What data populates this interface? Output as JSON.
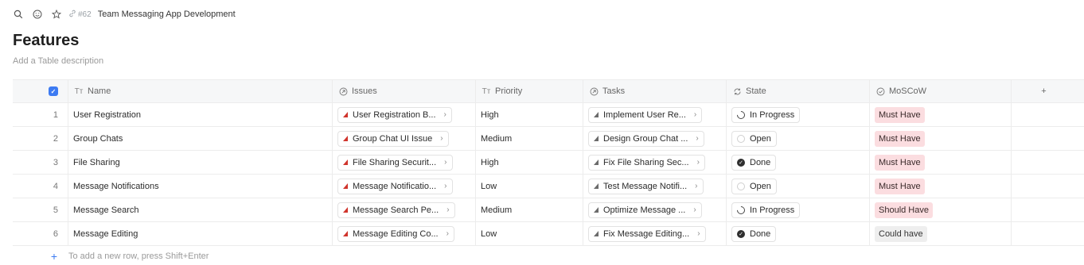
{
  "topbar": {
    "ref": "#62",
    "breadcrumb": "Team Messaging App Development"
  },
  "page": {
    "title": "Features",
    "description_placeholder": "Add a Table description"
  },
  "columns": {
    "name": "Name",
    "issues": "Issues",
    "priority": "Priority",
    "tasks": "Tasks",
    "state": "State",
    "moscow": "MoSCoW",
    "add": "+"
  },
  "rows": [
    {
      "idx": "1",
      "name": "User Registration",
      "issue": "User Registration B...",
      "priority": "High",
      "task": "Implement User Re...",
      "state": "In Progress",
      "state_kind": "progress",
      "moscow": "Must Have",
      "moscow_kind": "must"
    },
    {
      "idx": "2",
      "name": "Group Chats",
      "issue": "Group Chat UI Issue",
      "priority": "Medium",
      "task": "Design Group Chat ...",
      "state": "Open",
      "state_kind": "open",
      "moscow": "Must Have",
      "moscow_kind": "must"
    },
    {
      "idx": "3",
      "name": "File Sharing",
      "issue": "File Sharing Securit...",
      "priority": "High",
      "task": "Fix File Sharing Sec...",
      "state": "Done",
      "state_kind": "done",
      "moscow": "Must Have",
      "moscow_kind": "must"
    },
    {
      "idx": "4",
      "name": "Message Notifications",
      "issue": "Message Notificatio...",
      "priority": "Low",
      "task": "Test Message Notifi...",
      "state": "Open",
      "state_kind": "open",
      "moscow": "Must Have",
      "moscow_kind": "must"
    },
    {
      "idx": "5",
      "name": "Message Search",
      "issue": "Message Search Pe...",
      "priority": "Medium",
      "task": "Optimize Message ...",
      "state": "In Progress",
      "state_kind": "progress",
      "moscow": "Should Have",
      "moscow_kind": "should"
    },
    {
      "idx": "6",
      "name": "Message Editing",
      "issue": "Message Editing Co...",
      "priority": "Low",
      "task": "Fix Message Editing...",
      "state": "Done",
      "state_kind": "done",
      "moscow": "Could have",
      "moscow_kind": "could"
    }
  ],
  "footer": {
    "add_row_hint": "To add a new row, press Shift+Enter"
  },
  "icons": {
    "search": "search-icon",
    "emoji": "smiley-icon",
    "star": "star-icon",
    "link": "link-icon"
  },
  "colors": {
    "accent": "#3d7bf2",
    "issue_red": "#d0342c",
    "must_have_bg": "#fbdde0",
    "could_have_bg": "#eeeeee"
  }
}
